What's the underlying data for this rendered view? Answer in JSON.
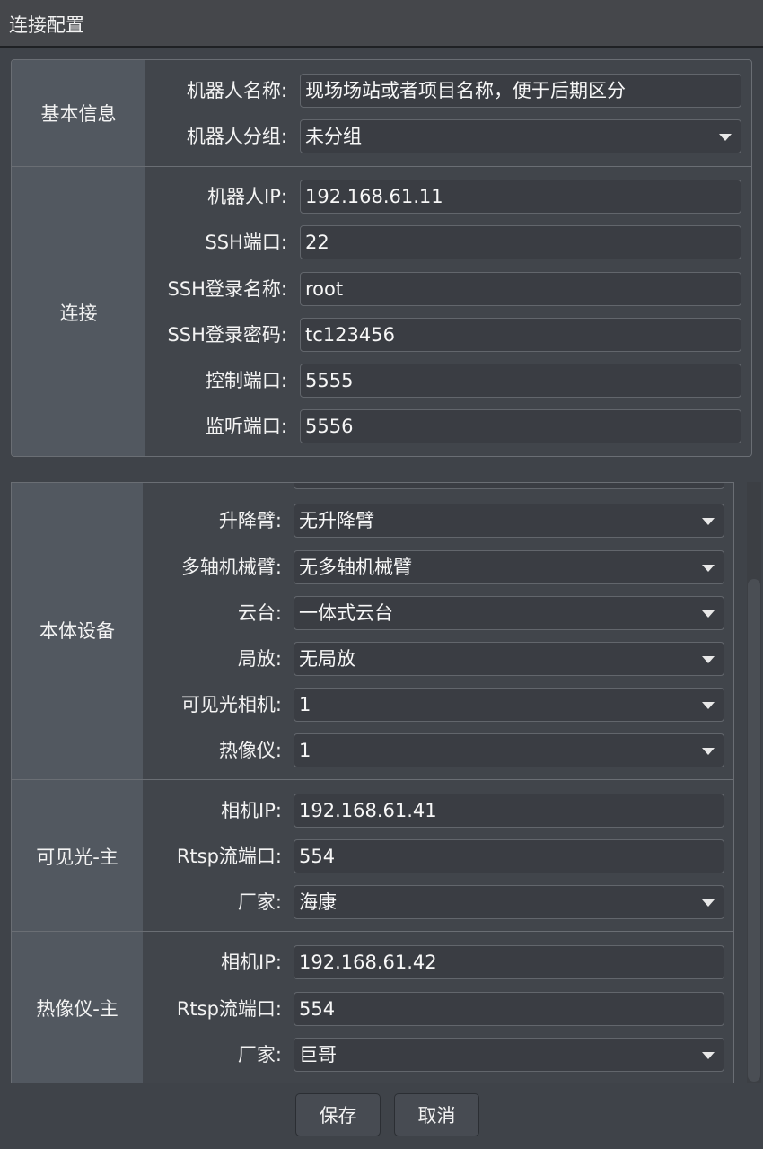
{
  "window": {
    "title": "连接配置"
  },
  "basic": {
    "label": "基本信息",
    "name_label": "机器人名称:",
    "name_value": "现场场站或者项目名称，便于后期区分",
    "group_label": "机器人分组:",
    "group_value": "未分组"
  },
  "connection": {
    "label": "连接",
    "rows": [
      {
        "label": "机器人IP:",
        "value": "192.168.61.11"
      },
      {
        "label": "SSH端口:",
        "value": "22"
      },
      {
        "label": "SSH登录名称:",
        "value": "root"
      },
      {
        "label": "SSH登录密码:",
        "value": "tc123456"
      },
      {
        "label": "控制端口:",
        "value": "5555"
      },
      {
        "label": "监听端口:",
        "value": "5556"
      }
    ]
  },
  "body_device": {
    "label": "本体设备",
    "rows": [
      {
        "label": "升降臂:",
        "value": "无升降臂"
      },
      {
        "label": "多轴机械臂:",
        "value": "无多轴机械臂"
      },
      {
        "label": "云台:",
        "value": "一体式云台"
      },
      {
        "label": "局放:",
        "value": "无局放"
      },
      {
        "label": "可见光相机:",
        "value": "1"
      },
      {
        "label": "热像仪:",
        "value": "1"
      }
    ]
  },
  "visible_main": {
    "label": "可见光-主",
    "ip_label": "相机IP:",
    "ip_value": "192.168.61.41",
    "port_label": "Rtsp流端口:",
    "port_value": "554",
    "vendor_label": "厂家:",
    "vendor_value": "海康"
  },
  "thermal_main": {
    "label": "热像仪-主",
    "ip_label": "相机IP:",
    "ip_value": "192.168.61.42",
    "port_label": "Rtsp流端口:",
    "port_value": "554",
    "vendor_label": "厂家:",
    "vendor_value": "巨哥"
  },
  "buttons": {
    "save": "保存",
    "cancel": "取消"
  },
  "icons": {
    "dropdown": "chevron-down-icon"
  },
  "colors": {
    "background": "#3f4349",
    "label_column": "#525860",
    "field": "#3a3d43",
    "border": "#6a6e74"
  }
}
